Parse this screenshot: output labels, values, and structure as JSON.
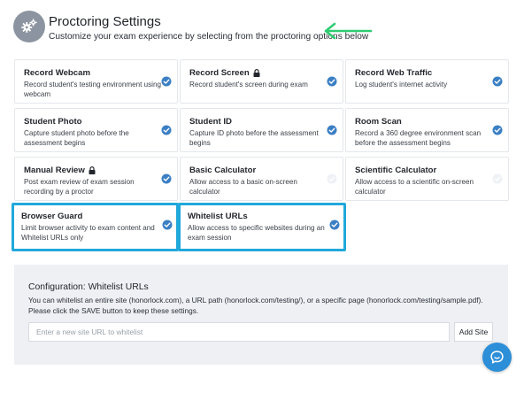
{
  "header": {
    "title": "Proctoring Settings",
    "subtitle": "Customize your exam experience by selecting from the proctoring options below",
    "icon": "gears-icon"
  },
  "annotation_color": "#2ecc71",
  "highlight_color": "#21a8db",
  "check_color": "#3b7fc4",
  "options": [
    {
      "title": "Record Webcam",
      "desc": "Record student's testing environment using webcam",
      "checked": true,
      "locked": false,
      "highlighted": false
    },
    {
      "title": "Record Screen",
      "desc": "Record student's screen during exam",
      "checked": true,
      "locked": true,
      "highlighted": false
    },
    {
      "title": "Record Web Traffic",
      "desc": "Log student's internet activity",
      "checked": true,
      "locked": false,
      "highlighted": false
    },
    {
      "title": "Student Photo",
      "desc": "Capture student photo before the assessment begins",
      "checked": true,
      "locked": false,
      "highlighted": false
    },
    {
      "title": "Student ID",
      "desc": "Capture ID photo before the assessment begins",
      "checked": true,
      "locked": false,
      "highlighted": false
    },
    {
      "title": "Room Scan",
      "desc": "Record a 360 degree environment scan before the assessment begins",
      "checked": true,
      "locked": false,
      "highlighted": false
    },
    {
      "title": "Manual Review",
      "desc": "Post exam review of exam session recording by a proctor",
      "checked": true,
      "locked": true,
      "highlighted": false
    },
    {
      "title": "Basic Calculator",
      "desc": "Allow access to a basic on-screen calculator",
      "checked": false,
      "locked": false,
      "highlighted": false
    },
    {
      "title": "Scientific Calculator",
      "desc": "Allow access to a scientific on-screen calculator",
      "checked": false,
      "locked": false,
      "highlighted": false
    },
    {
      "title": "Browser Guard",
      "desc": "Limit browser activity to exam content and Whitelist URLs only",
      "checked": true,
      "locked": false,
      "highlighted": true
    },
    {
      "title": "Whitelist URLs",
      "desc": "Allow access to specific websites during an exam session",
      "checked": true,
      "locked": false,
      "highlighted": true
    }
  ],
  "config": {
    "title": "Configuration: Whitelist URLs",
    "description": "You can whitelist an entire site (honorlock.com), a URL path (honorlock.com/testing/), or a specific page (honorlock.com/testing/sample.pdf). Please click the SAVE button to keep these settings.",
    "input_value": "",
    "input_placeholder": "Enter a new site URL to whitelist",
    "add_button_label": "Add Site"
  },
  "chat_icon": "chat-bubble-icon"
}
